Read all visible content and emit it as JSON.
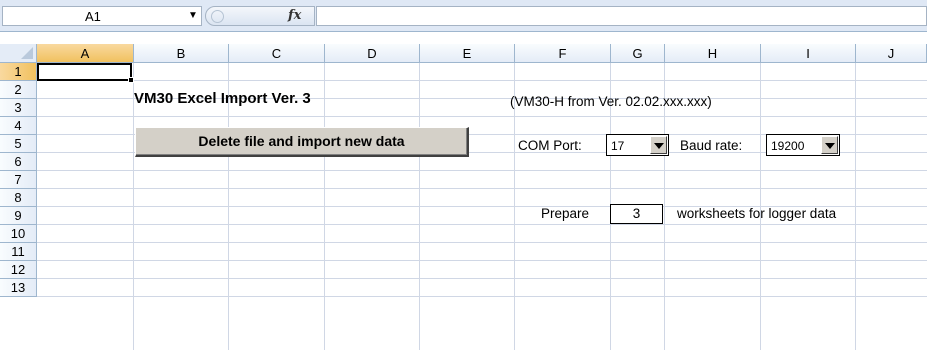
{
  "formula_bar": {
    "name_box": "A1",
    "fx_symbol": "fx",
    "formula": ""
  },
  "columns": [
    "A",
    "B",
    "C",
    "D",
    "E",
    "F",
    "G",
    "H",
    "I",
    "J"
  ],
  "rows": [
    "1",
    "2",
    "3",
    "4",
    "5",
    "6",
    "7",
    "8",
    "9",
    "10",
    "11",
    "12",
    "13"
  ],
  "selected_cell": "A1",
  "sheet": {
    "title": "VM30 Excel Import Ver. 3",
    "delete_button_label": "Delete file and import new data",
    "version_note": "(VM30-H from Ver. 02.02.xxx.xxx)",
    "com_port_label": "COM Port:",
    "com_port_value": "17",
    "baud_rate_label": "Baud rate:",
    "baud_rate_value": "19200",
    "prepare_label": "Prepare",
    "worksheets_count": "3",
    "worksheets_label": "worksheets for logger data"
  },
  "colors": {
    "header_bg": "#e4ecf7",
    "header_selected": "#f1c15f",
    "gridline": "#d0d7e5",
    "button_face": "#d4d0c8"
  }
}
